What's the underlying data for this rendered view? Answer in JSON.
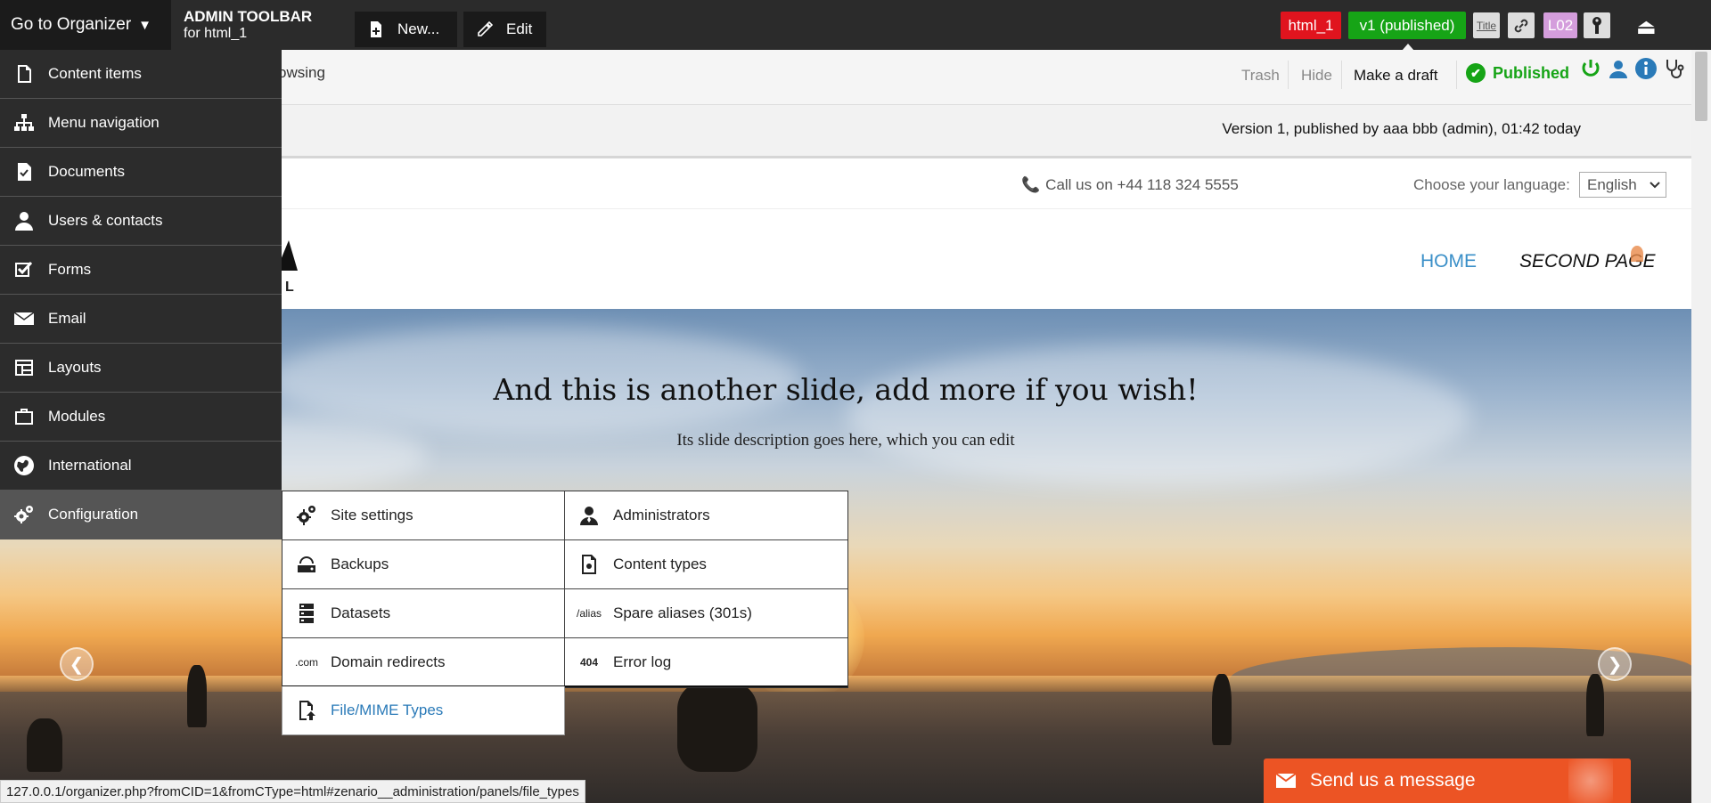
{
  "toolbar": {
    "goto_label": "Go to Organizer",
    "goto_arrow": "▼",
    "admin_title": "ADMIN TOOLBAR",
    "admin_subtitle": "for html_1",
    "new_label": "New...",
    "edit_label": "Edit",
    "content_tag": "html_1",
    "version_tag": "v1 (published)",
    "title_btn": "Title",
    "layout_tag": "L02"
  },
  "bar2": {
    "browsing_partial": "owsing",
    "trash": "Trash",
    "hide": "Hide",
    "make_draft": "Make a draft",
    "published": "Published",
    "check": "✔"
  },
  "version_info": "Version 1, published by aaa bbb (admin), 01:42 today",
  "site_header": {
    "call_us": "Call us on +44 118 324 5555",
    "lang_label": "Choose your language:",
    "lang_value": "English",
    "logo_letter": "L",
    "nav": {
      "home": "HOME",
      "second": "SECOND PAGE"
    }
  },
  "hero": {
    "title": "And this is another slide, add more if you wish!",
    "description": "Its slide description goes here, which you can edit",
    "prev": "❮",
    "next": "❯"
  },
  "organizer_menu": {
    "items": [
      {
        "label": "Content items",
        "icon": "document-icon"
      },
      {
        "label": "Menu navigation",
        "icon": "sitemap-icon"
      },
      {
        "label": "Documents",
        "icon": "file-check-icon"
      },
      {
        "label": "Users & contacts",
        "icon": "user-icon"
      },
      {
        "label": "Forms",
        "icon": "checkbox-icon"
      },
      {
        "label": "Email",
        "icon": "envelope-icon"
      },
      {
        "label": "Layouts",
        "icon": "layout-icon"
      },
      {
        "label": "Modules",
        "icon": "briefcase-icon"
      },
      {
        "label": "International",
        "icon": "globe-icon"
      },
      {
        "label": "Configuration",
        "icon": "gears-icon"
      }
    ]
  },
  "config_submenu": {
    "site_settings": "Site settings",
    "administrators": "Administrators",
    "backups": "Backups",
    "content_types": "Content types",
    "datasets": "Datasets",
    "spare_aliases": "Spare aliases (301s)",
    "alias_icon_text": "/alias",
    "domain_redirects": "Domain redirects",
    "com_icon_text": ".com",
    "error_log": "Error log",
    "error_icon_text": "404",
    "file_mime": "File/MIME Types"
  },
  "send_message": "Send us a message",
  "status_url": "127.0.0.1/organizer.php?fromCID=1&fromCType=html#zenario__administration/panels/file_types",
  "colors": {
    "content_tag_bg": "#e0141e",
    "version_tag_bg": "#16a416",
    "layout_tag_bg": "#d49ddc",
    "published_green": "#16a416",
    "send_msg_bg": "#ec5424",
    "link_blue": "#2a7ab8"
  }
}
